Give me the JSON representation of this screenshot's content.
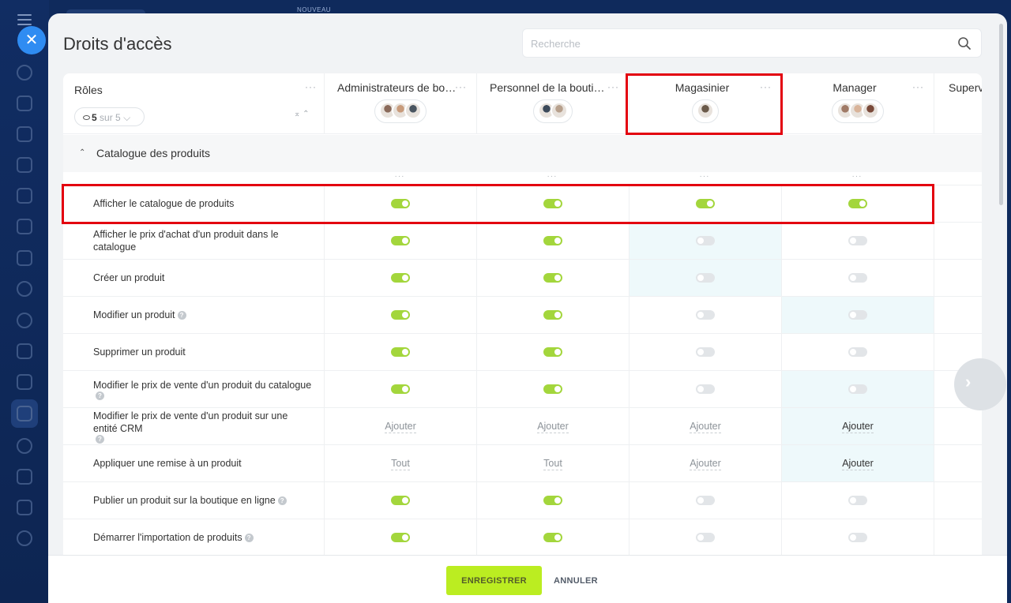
{
  "top": {
    "nouveau": "NOUVEAU"
  },
  "panel": {
    "title": "Droits d'accès",
    "search_placeholder": "Recherche"
  },
  "roles": {
    "label": "Rôles",
    "filter_count": "5",
    "filter_total": "sur 5"
  },
  "columns": [
    {
      "name": "Administrateurs de boutique",
      "avatars": [
        "#8a6a5a",
        "#c89b7b",
        "#4a5560"
      ]
    },
    {
      "name": "Personnel de la boutique",
      "avatars": [
        "#3c4a5a",
        "#b7a08c"
      ]
    },
    {
      "name": "Magasinier",
      "avatars": [
        "#6b5a4a"
      ]
    },
    {
      "name": "Manager",
      "avatars": [
        "#a07a66",
        "#d9b49a",
        "#7a4a3a"
      ]
    },
    {
      "name": "Superviseur",
      "avatars": []
    }
  ],
  "section": {
    "title": "Catalogue des produits"
  },
  "rows": [
    {
      "label": "Afficher le catalogue de produits",
      "help": false,
      "cells": [
        {
          "t": "toggle",
          "on": true
        },
        {
          "t": "toggle",
          "on": true
        },
        {
          "t": "toggle",
          "on": true
        },
        {
          "t": "toggle",
          "on": true
        }
      ]
    },
    {
      "label": "Afficher le prix d'achat d'un produit dans le catalogue",
      "help": false,
      "cells": [
        {
          "t": "toggle",
          "on": true
        },
        {
          "t": "toggle",
          "on": true
        },
        {
          "t": "toggle",
          "on": false,
          "hl": true
        },
        {
          "t": "toggle",
          "on": false
        }
      ]
    },
    {
      "label": "Créer un produit",
      "help": false,
      "cells": [
        {
          "t": "toggle",
          "on": true
        },
        {
          "t": "toggle",
          "on": true
        },
        {
          "t": "toggle",
          "on": false,
          "hl": true
        },
        {
          "t": "toggle",
          "on": false
        }
      ]
    },
    {
      "label": "Modifier un produit",
      "help": true,
      "cells": [
        {
          "t": "toggle",
          "on": true
        },
        {
          "t": "toggle",
          "on": true
        },
        {
          "t": "toggle",
          "on": false
        },
        {
          "t": "toggle",
          "on": false,
          "hl": true
        }
      ]
    },
    {
      "label": "Supprimer un produit",
      "help": false,
      "cells": [
        {
          "t": "toggle",
          "on": true
        },
        {
          "t": "toggle",
          "on": true
        },
        {
          "t": "toggle",
          "on": false
        },
        {
          "t": "toggle",
          "on": false
        }
      ]
    },
    {
      "label": "Modifier le prix de vente d'un produit du catalogue",
      "help": true,
      "cells": [
        {
          "t": "toggle",
          "on": true
        },
        {
          "t": "toggle",
          "on": true
        },
        {
          "t": "toggle",
          "on": false
        },
        {
          "t": "toggle",
          "on": false,
          "hl": true
        }
      ]
    },
    {
      "label": "Modifier le prix de vente d'un produit sur une entité CRM",
      "help": true,
      "cells": [
        {
          "t": "text",
          "v": "Ajouter"
        },
        {
          "t": "text",
          "v": "Ajouter"
        },
        {
          "t": "text",
          "v": "Ajouter"
        },
        {
          "t": "text",
          "v": "Ajouter",
          "hl": true,
          "dark": true
        }
      ]
    },
    {
      "label": "Appliquer une remise à un produit",
      "help": false,
      "cells": [
        {
          "t": "text",
          "v": "Tout"
        },
        {
          "t": "text",
          "v": "Tout"
        },
        {
          "t": "text",
          "v": "Ajouter"
        },
        {
          "t": "text",
          "v": "Ajouter",
          "hl": true,
          "dark": true
        }
      ]
    },
    {
      "label": "Publier un produit sur la boutique en ligne",
      "help": true,
      "cells": [
        {
          "t": "toggle",
          "on": true
        },
        {
          "t": "toggle",
          "on": true
        },
        {
          "t": "toggle",
          "on": false
        },
        {
          "t": "toggle",
          "on": false
        }
      ]
    },
    {
      "label": "Démarrer l'importation de produits",
      "help": true,
      "cells": [
        {
          "t": "toggle",
          "on": true
        },
        {
          "t": "toggle",
          "on": true
        },
        {
          "t": "toggle",
          "on": false
        },
        {
          "t": "toggle",
          "on": false
        }
      ]
    }
  ],
  "footer": {
    "save": "ENREGISTRER",
    "cancel": "ANNULER"
  },
  "colors": {
    "accent_green": "#bbed21",
    "toggle_on": "#a3d63c",
    "highlight": "#e3000f",
    "close_blue": "#2f8cf2"
  }
}
